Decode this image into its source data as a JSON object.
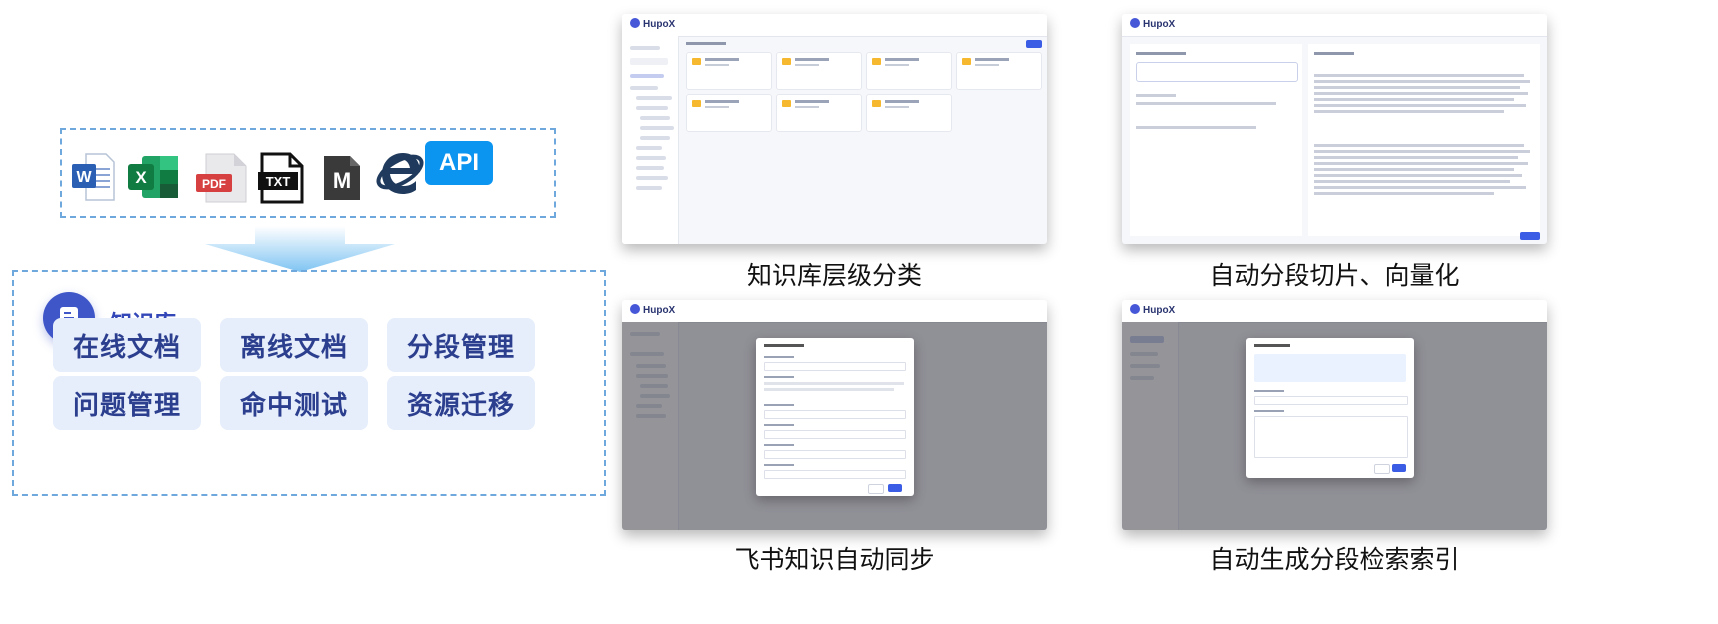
{
  "sources": {
    "icons": [
      "word-icon",
      "excel-icon",
      "pdf-icon",
      "txt-icon",
      "markdown-icon",
      "ie-icon",
      "api-icon"
    ],
    "word_letter": "W",
    "excel_letter": "X",
    "pdf_label": "PDF",
    "txt_label": "TXT",
    "markdown_letter": "M",
    "api_label": "API"
  },
  "knowledge_base": {
    "title": "知识库",
    "features": [
      "在线文档",
      "离线文档",
      "分段管理",
      "问题管理",
      "命中测试",
      "资源迁移"
    ]
  },
  "screenshots": [
    {
      "caption": "知识库层级分类",
      "brand": "HupoX"
    },
    {
      "caption": "自动分段切片、向量化",
      "brand": "HupoX"
    },
    {
      "caption": "飞书知识自动同步",
      "brand": "HupoX"
    },
    {
      "caption": "自动生成分段检索索引",
      "brand": "HupoX"
    }
  ],
  "colors": {
    "accent": "#3f56c8",
    "feature_bg": "#e6eefb",
    "dash": "#6fa8dc"
  }
}
